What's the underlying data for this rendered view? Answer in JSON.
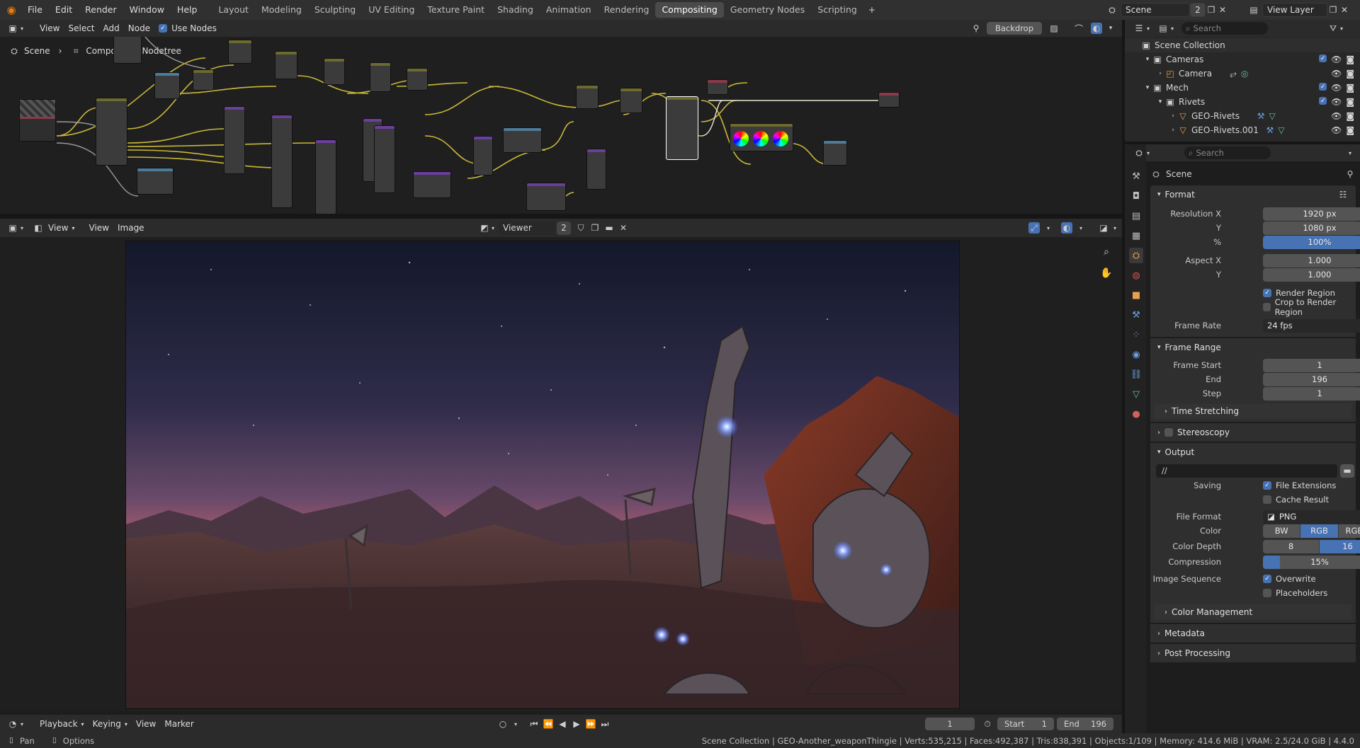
{
  "menu": {
    "items": [
      "File",
      "Edit",
      "Render",
      "Window",
      "Help"
    ]
  },
  "workspaces": {
    "tabs": [
      "Layout",
      "Modeling",
      "Sculpting",
      "UV Editing",
      "Texture Paint",
      "Shading",
      "Animation",
      "Rendering",
      "Compositing",
      "Geometry Nodes",
      "Scripting"
    ],
    "active": "Compositing"
  },
  "scene": {
    "name": "Scene",
    "users": "2",
    "view_layer": "View Layer"
  },
  "node_editor": {
    "menu": [
      "View",
      "Select",
      "Add",
      "Node"
    ],
    "use_nodes_label": "Use Nodes",
    "breadcrumb_scene": "Scene",
    "breadcrumb_tree": "Compositing Nodetree",
    "backdrop_label": "Backdrop"
  },
  "image_editor": {
    "menu": [
      "View",
      "View",
      "Image"
    ],
    "image_name": "Viewer Node",
    "image_users": "2"
  },
  "outliner": {
    "search_placeholder": "Search",
    "rows": [
      {
        "label": "Scene Collection"
      },
      {
        "label": "Cameras"
      },
      {
        "label": "Camera"
      },
      {
        "label": "Mech"
      },
      {
        "label": "Rivets"
      },
      {
        "label": "GEO-Rivets"
      },
      {
        "label": "GEO-Rivets.001"
      }
    ]
  },
  "properties": {
    "search_placeholder": "Search",
    "context": "Scene",
    "format": {
      "title": "Format",
      "res_x_label": "Resolution X",
      "res_x": "1920 px",
      "res_y_label": "Y",
      "res_y": "1080 px",
      "pct_label": "%",
      "pct": "100%",
      "aspect_x_label": "Aspect X",
      "aspect_x": "1.000",
      "aspect_y_label": "Y",
      "aspect_y": "1.000",
      "render_region": "Render Region",
      "crop_region": "Crop to Render Region",
      "frame_rate_label": "Frame Rate",
      "frame_rate": "24 fps"
    },
    "frame_range": {
      "title": "Frame Range",
      "start_label": "Frame Start",
      "start": "1",
      "end_label": "End",
      "end": "196",
      "step_label": "Step",
      "step": "1",
      "time_stretching": "Time Stretching"
    },
    "stereoscopy": "Stereoscopy",
    "output": {
      "title": "Output",
      "path": "//",
      "saving_label": "Saving",
      "file_extensions": "File Extensions",
      "cache_result": "Cache Result",
      "file_format_label": "File Format",
      "file_format": "PNG",
      "color_label": "Color",
      "color_opts": [
        "BW",
        "RGB",
        "RGBA"
      ],
      "color_selected": "RGB",
      "depth_label": "Color Depth",
      "depth_opts": [
        "8",
        "16"
      ],
      "depth_selected": "16",
      "compression_label": "Compression",
      "compression": "15%",
      "compression_value": 0.15,
      "image_seq_label": "Image Sequence",
      "overwrite": "Overwrite",
      "placeholders": "Placeholders",
      "color_management": "Color Management"
    },
    "metadata": "Metadata",
    "post_processing": "Post Processing"
  },
  "timeline": {
    "menu": [
      "Playback",
      "Keying",
      "View",
      "Marker"
    ],
    "current_frame": "1",
    "start_label": "Start",
    "start": "1",
    "end_label": "End",
    "end": "196"
  },
  "status": {
    "left": [
      "Pan",
      "Options"
    ],
    "right": "Scene Collection | GEO-Another_weaponThingie | Verts:535,215 | Faces:492,387 | Tris:838,391 | Objects:1/109 | Memory: 414.6 MiB | VRAM: 2.5/24.0 GiB | 4.4.0"
  },
  "colors": {
    "accent": "#4772b3",
    "active_tab": "#4a4a4a",
    "panel_bg": "#282828",
    "node_wire": "#c9b838"
  }
}
